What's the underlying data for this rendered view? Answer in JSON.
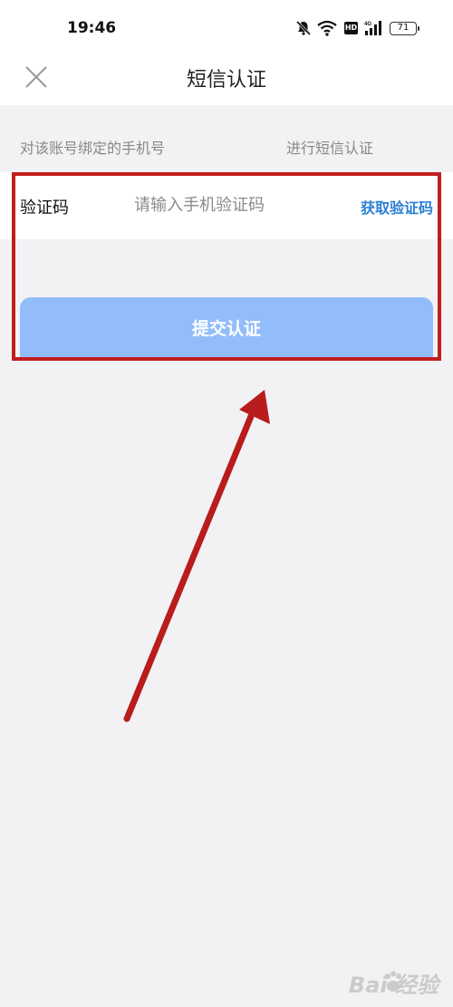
{
  "status_bar": {
    "time": "19:46",
    "hd": "HD",
    "battery": "71"
  },
  "header": {
    "title": "短信认证"
  },
  "notice": {
    "left": "对该账号绑定的手机号",
    "right": "进行短信认证"
  },
  "code_row": {
    "label": "验证码",
    "placeholder": "请输入手机验证码",
    "value": "",
    "get_code": "获取验证码"
  },
  "submit": {
    "label": "提交认证"
  },
  "watermark": {
    "text": "Bai  经验"
  },
  "colors": {
    "accent": "#2a7fd4",
    "submit_bg": "#92bdfa",
    "annotation": "#c21d1d",
    "background": "#f2f2f4"
  }
}
